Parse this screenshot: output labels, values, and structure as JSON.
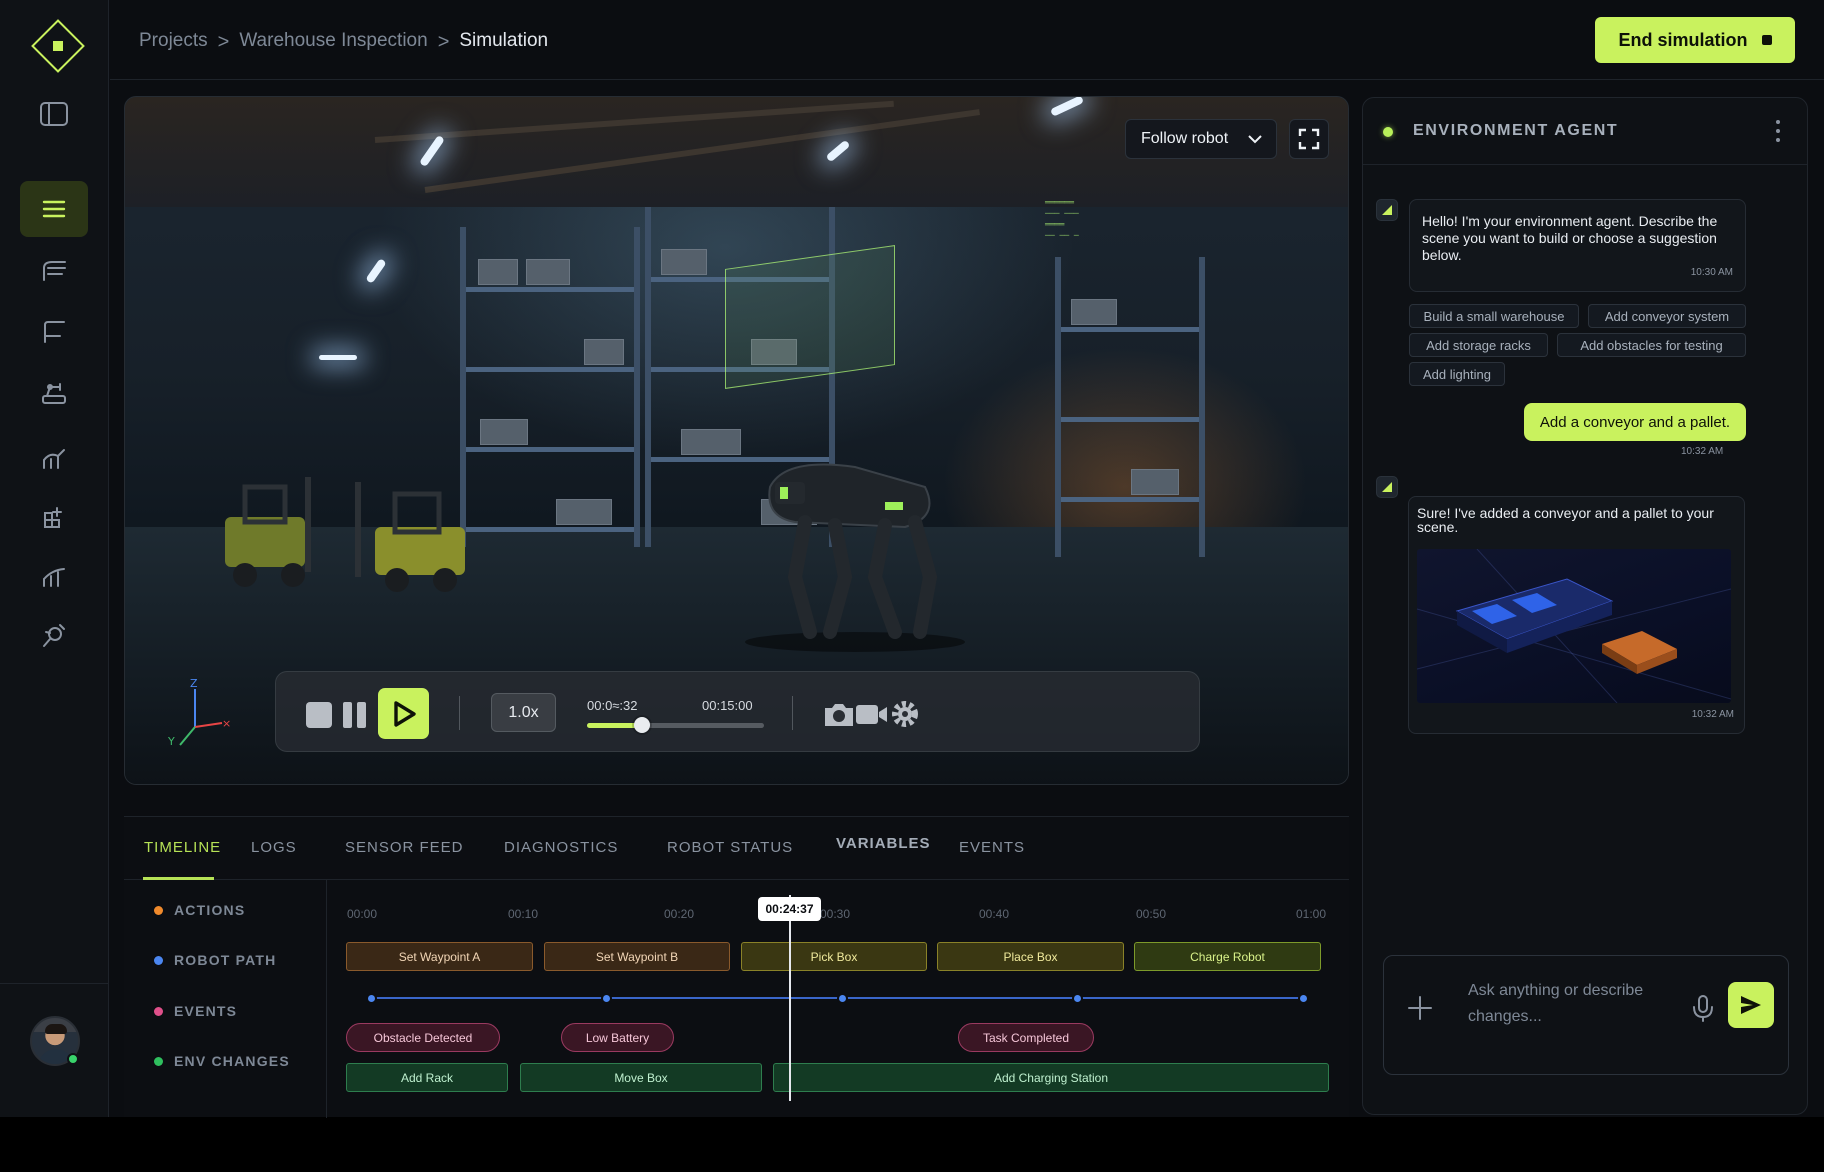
{
  "breadcrumb": {
    "items": [
      "Projects",
      "Warehouse Inspection",
      "Simulation"
    ],
    "separator": ">"
  },
  "header": {
    "end_button_label": "End simulation"
  },
  "rail": {
    "items": [
      "logo-icon",
      "sidebar-toggle-icon",
      "menu-icon",
      "layers-icon",
      "flag-icon",
      "robot-arm-icon",
      "analytics-icon",
      "add-widget-icon",
      "stats-icon",
      "integrations-icon"
    ],
    "active_item": "menu-icon"
  },
  "viewport": {
    "camera_mode": "Follow robot",
    "axis": {
      "z": "Z",
      "y": "Y"
    },
    "speed": "1.0x",
    "current_time": "00:0≈:32",
    "total_time": "00:15:00",
    "progress": 0.31
  },
  "bottom": {
    "tabs": [
      "TIMELINE",
      "LOGS",
      "SENSOR FEED",
      "DIAGNOSTICS",
      "ROBOT STATUS",
      "VARIABLES",
      "EVENTS"
    ],
    "active_tab": "TIMELINE",
    "tracks": [
      {
        "label": "ACTIONS",
        "color": "#f08a2c"
      },
      {
        "label": "ROBOT PATH",
        "color": "#4b86f0"
      },
      {
        "label": "EVENTS",
        "color": "#e0508a"
      },
      {
        "label": "ENV CHANGES",
        "color": "#2fbf5e"
      }
    ],
    "ruler": [
      "00:00",
      "00:10",
      "00:20",
      "00:30",
      "00:40",
      "00:50",
      "01:00"
    ],
    "playhead": "00:24:37",
    "actions": [
      "Set Waypoint A",
      "Set Waypoint B",
      "Pick Box",
      "Place Box",
      "Charge Robot"
    ],
    "events": [
      "Obstacle Detected",
      "Low Battery",
      "Task Completed"
    ],
    "env_changes": [
      "Add Rack",
      "Move Box",
      "Add Charging Station"
    ]
  },
  "agent": {
    "title": "ENVIRONMENT AGENT",
    "greeting": "Hello! I'm your environment agent. Describe the scene you want to build or choose a suggestion below.",
    "greeting_time": "10:30 AM",
    "suggestions": [
      "Build a small warehouse",
      "Add conveyor system",
      "Add storage racks",
      "Add obstacles for testing",
      "Add lighting"
    ],
    "user_message": "Add a conveyor and a pallet.",
    "user_time": "10:32 AM",
    "reply": "Sure! I've added a conveyor and a pallet to your scene.",
    "reply_time": "10:32 AM",
    "composer_placeholder": "Ask anything or describe changes..."
  },
  "colors": {
    "accent": "#c9f25e",
    "background": "#0b0d11"
  }
}
